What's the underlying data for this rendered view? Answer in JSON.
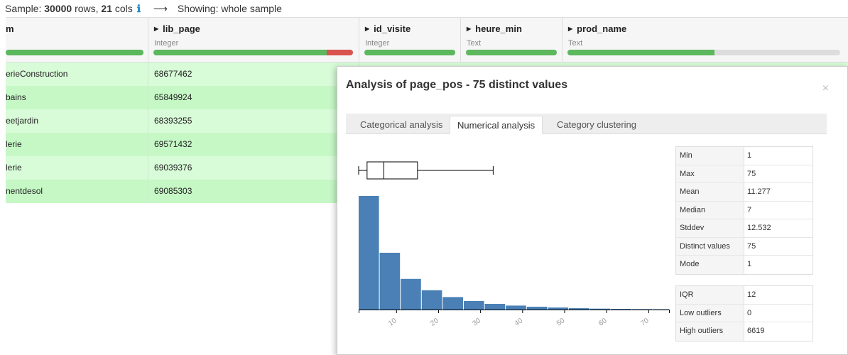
{
  "sample": {
    "prefix": "Sample:",
    "rows": "30000",
    "rows_label": "rows,",
    "cols": "21",
    "cols_label": "cols",
    "showing": "Showing: whole sample"
  },
  "columns": [
    {
      "name": "m",
      "type": "",
      "ok": 1.0,
      "bad": 0
    },
    {
      "name": "lib_page",
      "type": "Integer",
      "ok": 0.87,
      "bad": 0.13
    },
    {
      "name": "id_visite",
      "type": "Integer",
      "ok": 1.0,
      "bad": 0
    },
    {
      "name": "heure_min",
      "type": "Text",
      "ok": 1.0,
      "bad": 0
    },
    {
      "name": "prod_name",
      "type": "Text",
      "ok": 0.54,
      "bad": 0
    }
  ],
  "rows": [
    [
      "erieConstruction",
      "68677462"
    ],
    [
      "bains",
      "65849924"
    ],
    [
      "eetjardin",
      "68393255"
    ],
    [
      "lerie",
      "69571432"
    ],
    [
      "lerie",
      "69039376"
    ],
    [
      "nentdesol",
      "69085303"
    ]
  ],
  "modal": {
    "title": "Analysis of page_pos - 75 distinct values",
    "tabs": [
      "Categorical analysis",
      "Numerical analysis",
      "Category clustering"
    ],
    "active_tab": 1,
    "stats_main": [
      {
        "label": "Min",
        "value": "1"
      },
      {
        "label": "Max",
        "value": "75"
      },
      {
        "label": "Mean",
        "value": "11.277"
      },
      {
        "label": "Median",
        "value": "7"
      },
      {
        "label": "Stddev",
        "value": "12.532"
      },
      {
        "label": "Distinct values",
        "value": "75"
      },
      {
        "label": "Mode",
        "value": "1"
      }
    ],
    "stats_outliers": [
      {
        "label": "IQR",
        "value": "12"
      },
      {
        "label": "Low outliers",
        "value": "0"
      },
      {
        "label": "High outliers",
        "value": "6619"
      }
    ]
  },
  "chart_data": {
    "type": "bar",
    "bar_color": "#4a80b5",
    "x_ticks": [
      "10",
      "20",
      "30",
      "40",
      "50",
      "60",
      "70"
    ],
    "bin_width": 5,
    "bins_start": 1,
    "values": [
      100,
      50,
      27,
      17,
      11,
      7.5,
      5,
      3.5,
      2.5,
      1.8,
      1.2,
      0.8,
      0.6,
      0.4,
      0.3
    ],
    "boxplot": {
      "whisker_low": 1,
      "q1": 3,
      "median": 7,
      "q3": 15,
      "whisker_high": 33
    }
  }
}
